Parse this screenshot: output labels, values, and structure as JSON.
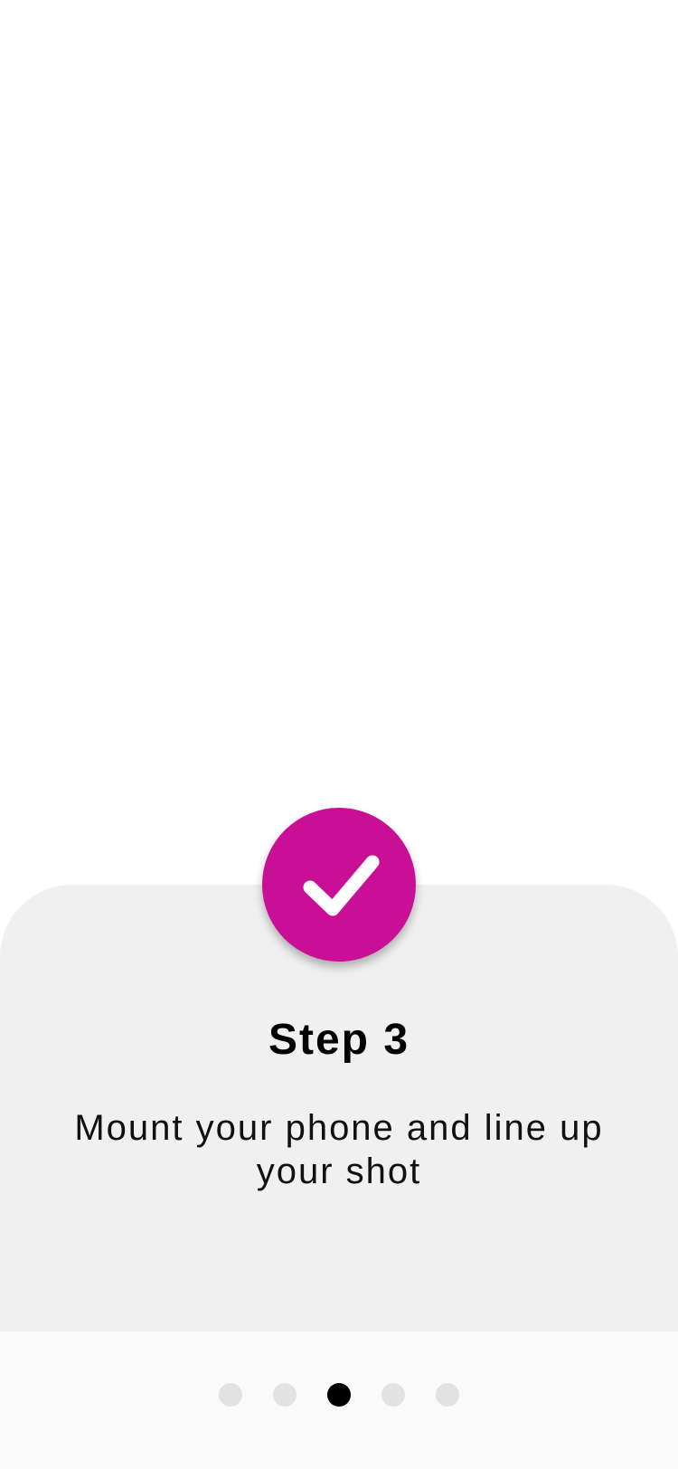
{
  "onboarding": {
    "step_title": "Step 3",
    "step_description": "Mount your phone and line up your shot",
    "icon": "checkmark-icon",
    "accent_color": "#c80f96",
    "card_color": "#f0f0f0"
  },
  "pagination": {
    "total_pages": 5,
    "current_page": 3
  }
}
